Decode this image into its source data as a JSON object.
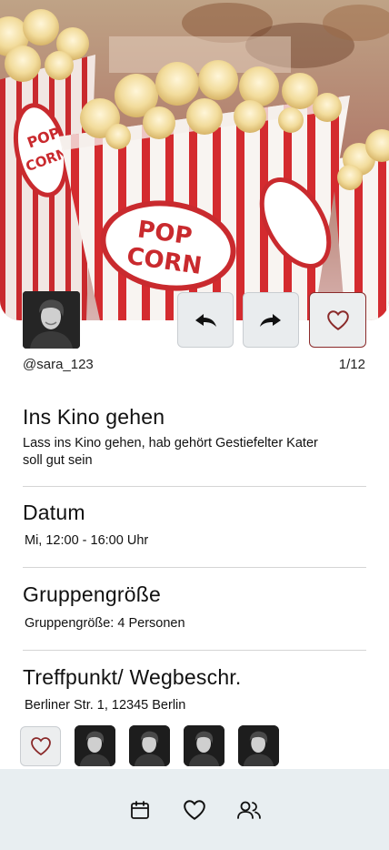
{
  "hero": {
    "image": "popcorn-image",
    "cup_label_top": "POP",
    "cup_label_bottom": "CORN"
  },
  "profile": {
    "username": "@sara_123",
    "counter": "1/12",
    "avatar": "person-avatar"
  },
  "actions": {
    "back_icon": "arrow-back-icon",
    "forward_icon": "arrow-forward-icon",
    "favorite_icon": "heart-icon",
    "favorite_color": "#8a2a2a"
  },
  "event": {
    "title": "Ins Kino gehen",
    "description": "Lass ins Kino gehen, hab gehört Gestiefelter Kater soll gut sein"
  },
  "date": {
    "heading": "Datum",
    "value": "Mi, 12:00 - 16:00 Uhr"
  },
  "group": {
    "heading": "Gruppengröße",
    "value": "Gruppengröße: 4 Personen"
  },
  "meeting": {
    "heading": "Treffpunkt/ Wegbeschr.",
    "value": "Berliner Str. 1, 12345 Berlin"
  },
  "participants": {
    "like_icon": "heart-icon",
    "avatars": [
      "person-avatar",
      "person-avatar",
      "person-avatar",
      "person-avatar"
    ]
  },
  "bottom_nav": {
    "items": [
      {
        "icon": "calendar-icon"
      },
      {
        "icon": "heart-icon"
      },
      {
        "icon": "users-icon"
      }
    ]
  },
  "colors": {
    "nav_background": "#e8eef1",
    "button_background": "#e9ecee",
    "accent_red": "#c8232b"
  }
}
